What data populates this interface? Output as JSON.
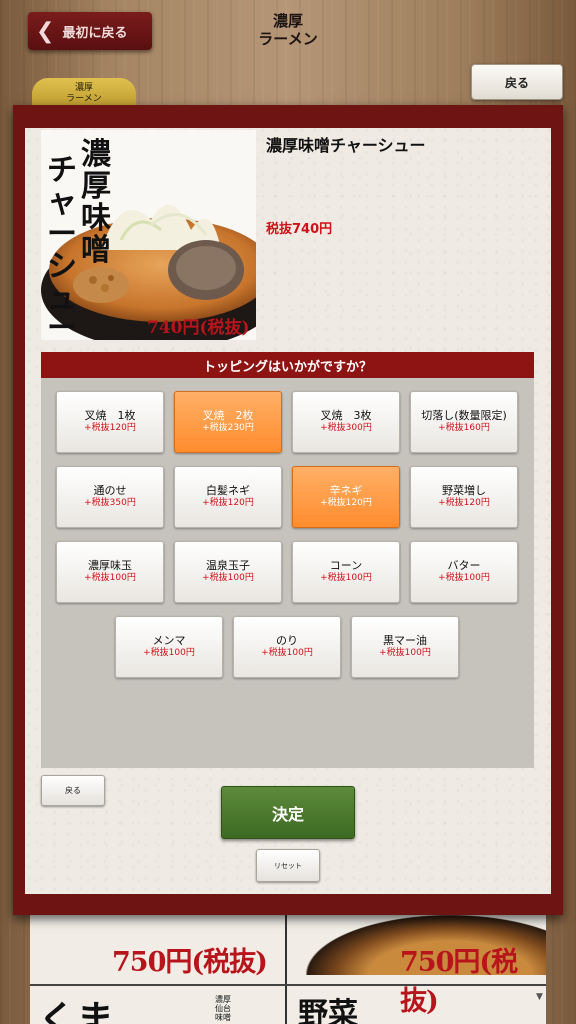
{
  "top": {
    "back_first_label": "最初に戻る",
    "title_line1": "濃厚",
    "title_line2": "ラーメン",
    "back_label": "戻る",
    "category_tab_line1": "濃厚",
    "category_tab_line2": "ラーメン"
  },
  "product": {
    "image_title": "濃厚味噌チャーシュー",
    "image_price": "740円(税抜)",
    "name": "濃厚味噌チャーシュー",
    "price": "税抜740円"
  },
  "toppings": {
    "header": "トッピングはいかがですか？",
    "items": [
      {
        "name": "叉焼　1枚",
        "price": "+税抜120円",
        "selected": false
      },
      {
        "name": "叉焼　2枚",
        "price": "+税抜230円",
        "selected": true
      },
      {
        "name": "叉焼　3枚",
        "price": "+税抜300円",
        "selected": false
      },
      {
        "name": "切落し(数量限定)",
        "price": "+税抜160円",
        "selected": false
      },
      {
        "name": "通のせ",
        "price": "+税抜350円",
        "selected": false
      },
      {
        "name": "白髪ネギ",
        "price": "+税抜120円",
        "selected": false
      },
      {
        "name": "辛ネギ",
        "price": "+税抜120円",
        "selected": true
      },
      {
        "name": "野菜増し",
        "price": "+税抜120円",
        "selected": false
      },
      {
        "name": "濃厚味玉",
        "price": "+税抜100円",
        "selected": false
      },
      {
        "name": "温泉玉子",
        "price": "+税抜100円",
        "selected": false
      },
      {
        "name": "コーン",
        "price": "+税抜100円",
        "selected": false
      },
      {
        "name": "バター",
        "price": "+税抜100円",
        "selected": false
      },
      {
        "name": "メンマ",
        "price": "+税抜100円",
        "selected": false
      },
      {
        "name": "のり",
        "price": "+税抜100円",
        "selected": false
      },
      {
        "name": "黒マー油",
        "price": "+税抜100円",
        "selected": false
      }
    ]
  },
  "actions": {
    "back_label": "戻る",
    "decide_label": "決定",
    "reset_label": "リセット"
  },
  "background_menu": {
    "price_left": "750円(税抜)",
    "price_right": "750円(税抜)",
    "big_left": "くま",
    "small_text": "濃厚仙台味噌",
    "big_right": "野菜"
  },
  "colors": {
    "modal_frame": "#6e1514",
    "header_red": "#8e1414",
    "selected_orange": "#ff8c2e",
    "price_red": "#d0111b",
    "decide_green": "#4a7a2e"
  },
  "icons": {
    "back_first": "chevron-left-icon",
    "scroll": "triangle-down-icon"
  }
}
